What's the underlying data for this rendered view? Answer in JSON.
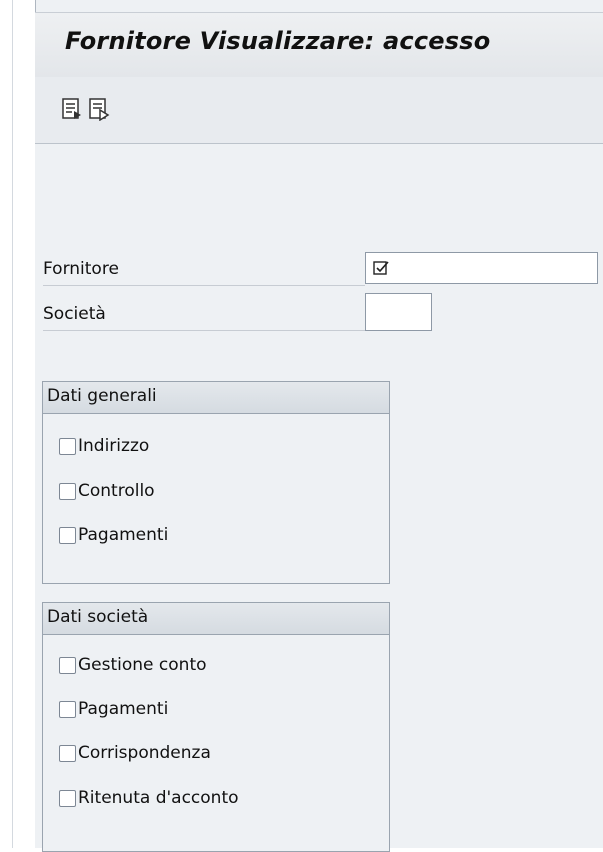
{
  "window": {
    "title": "Fornitore Visualizzare: accesso"
  },
  "toolbar": {
    "buttons": [
      {
        "icon": "document-list-icon"
      },
      {
        "icon": "document-display-icon"
      }
    ]
  },
  "fields": {
    "fornitore": {
      "label": "Fornitore",
      "value": "",
      "match_icon": "checkbox-search-help-icon"
    },
    "societa": {
      "label": "Società",
      "value": ""
    }
  },
  "groups": {
    "dati_generali": {
      "title": "Dati generali",
      "options": [
        {
          "label": "Indirizzo",
          "checked": false
        },
        {
          "label": "Controllo",
          "checked": false
        },
        {
          "label": "Pagamenti",
          "checked": false
        }
      ]
    },
    "dati_societa": {
      "title": "Dati società",
      "options": [
        {
          "label": "Gestione conto",
          "checked": false
        },
        {
          "label": "Pagamenti",
          "checked": false
        },
        {
          "label": "Corrispondenza",
          "checked": false
        },
        {
          "label": "Ritenuta d'acconto",
          "checked": false
        }
      ]
    }
  },
  "colors": {
    "background": "#eef1f4",
    "header": "#d5dbe1",
    "border": "#9aa4af"
  }
}
